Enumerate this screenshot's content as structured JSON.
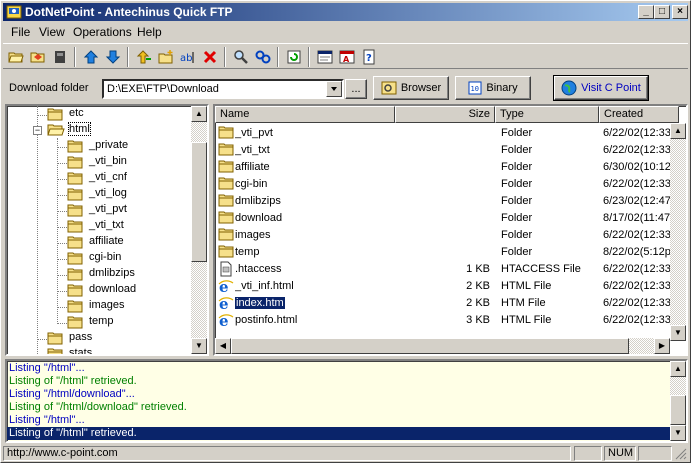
{
  "window": {
    "title": "DotNetPoint - Antechinus Quick FTP",
    "controls": [
      "_",
      "□",
      "×"
    ]
  },
  "menu": [
    "File",
    "View",
    "Operations",
    "Help"
  ],
  "toolbar": {
    "buttons": [
      "open-folder-icon",
      "new-connection-icon",
      "disconnect-icon",
      "upload-icon",
      "download-icon",
      "parent-folder-icon",
      "new-folder-icon",
      "rename-icon",
      "delete-icon",
      "find-icon",
      "refresh-connection-icon",
      "refresh-icon",
      "ftp-sites-icon",
      "transcript-icon",
      "help-icon"
    ]
  },
  "folderbar": {
    "label": "Download folder",
    "path": "D:\\EXE\\FTP\\Download",
    "browse_small": "...",
    "browser_label": "Browser",
    "binary_label": "Binary",
    "visit_label": "Visit C Point"
  },
  "tree": {
    "top_items": [
      "etc",
      "html"
    ],
    "html_children": [
      "_private",
      "_vti_bin",
      "_vti_cnf",
      "_vti_log",
      "_vti_pvt",
      "_vti_txt",
      "affiliate",
      "cgi-bin",
      "dmlibzips",
      "download",
      "images",
      "temp"
    ],
    "bottom_items": [
      "pass",
      "stats"
    ]
  },
  "list": {
    "columns": [
      "Name",
      "Size",
      "Type",
      "Created"
    ],
    "rows": [
      {
        "name": "_vti_pvt",
        "size": "",
        "type": "Folder",
        "created": "6/22/02(12:33",
        "icon": "folder"
      },
      {
        "name": "_vti_txt",
        "size": "",
        "type": "Folder",
        "created": "6/22/02(12:33",
        "icon": "folder"
      },
      {
        "name": "affiliate",
        "size": "",
        "type": "Folder",
        "created": "6/30/02(10:12",
        "icon": "folder"
      },
      {
        "name": "cgi-bin",
        "size": "",
        "type": "Folder",
        "created": "6/22/02(12:33",
        "icon": "folder"
      },
      {
        "name": "dmlibzips",
        "size": "",
        "type": "Folder",
        "created": "6/23/02(12:47",
        "icon": "folder"
      },
      {
        "name": "download",
        "size": "",
        "type": "Folder",
        "created": "8/17/02(11:47",
        "icon": "folder"
      },
      {
        "name": "images",
        "size": "",
        "type": "Folder",
        "created": "6/22/02(12:33",
        "icon": "folder"
      },
      {
        "name": "temp",
        "size": "",
        "type": "Folder",
        "created": "8/22/02(5:12p",
        "icon": "folder"
      },
      {
        "name": ".htaccess",
        "size": "1 KB",
        "type": "HTACCESS File",
        "created": "6/22/02(12:33",
        "icon": "file"
      },
      {
        "name": "_vti_inf.html",
        "size": "2 KB",
        "type": "HTML File",
        "created": "6/22/02(12:33",
        "icon": "ie"
      },
      {
        "name": "index.htm",
        "size": "2 KB",
        "type": "HTM File",
        "created": "6/22/02(12:33",
        "icon": "ie"
      },
      {
        "name": "postinfo.html",
        "size": "3 KB",
        "type": "HTML File",
        "created": "6/22/02(12:33",
        "icon": "ie"
      }
    ],
    "selected_index": 10
  },
  "log": {
    "lines": [
      {
        "text": "Listing \"/html\"...",
        "color": "#0000c0"
      },
      {
        "text": "Listing of \"/html\" retrieved.",
        "color": "#008000"
      },
      {
        "text": "Listing \"/html/download\"...",
        "color": "#0000c0"
      },
      {
        "text": "Listing of \"/html/download\" retrieved.",
        "color": "#008000"
      },
      {
        "text": "Listing \"/html\"...",
        "color": "#0000c0"
      },
      {
        "text": "Listing of \"/html\" retrieved.",
        "color": "#ffffff"
      }
    ],
    "selected_index": 5
  },
  "status": {
    "url": "http://www.c-point.com",
    "num": "NUM"
  },
  "colors": {
    "title_start": "#0a246a",
    "title_end": "#a6caf0",
    "selection": "#0a246a",
    "log_bg": "#ffffe6",
    "folder": "#f6e08a"
  }
}
